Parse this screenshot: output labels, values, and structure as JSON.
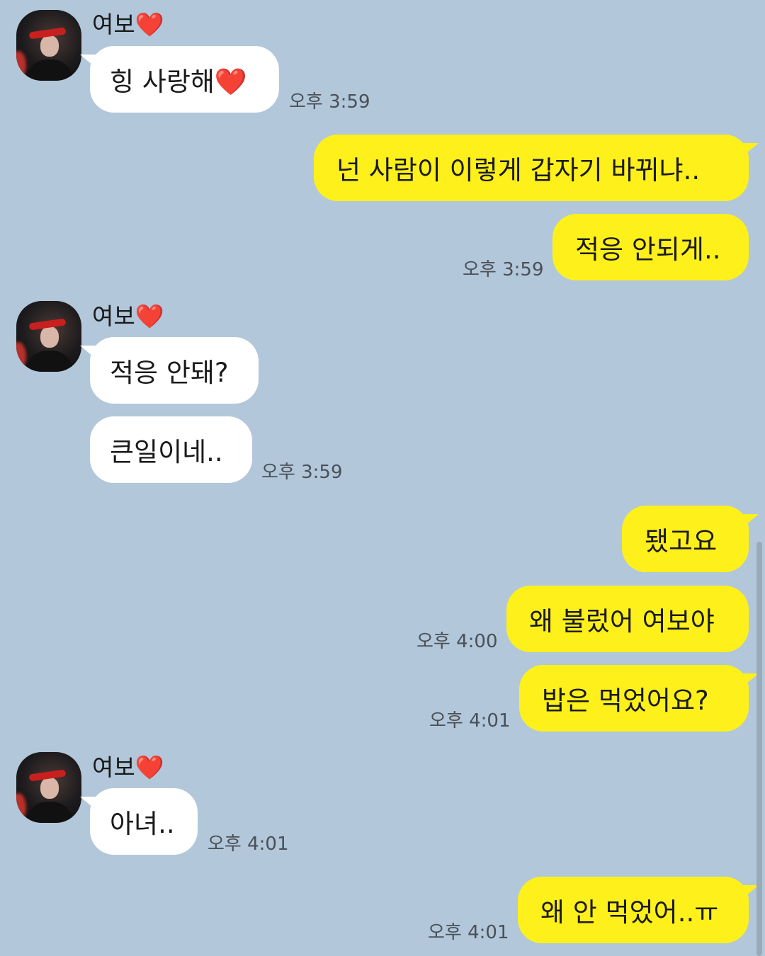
{
  "contact": {
    "name": "여보",
    "heart": "❤️"
  },
  "messages": [
    {
      "id": "m1",
      "side": "in",
      "text": "힝 사랑해❤️",
      "time": "오후 3:59"
    },
    {
      "id": "m2",
      "side": "out",
      "text": "넌 사람이 이렇게 갑자기 바뀌냐..",
      "time": ""
    },
    {
      "id": "m3",
      "side": "out",
      "text": "적응 안되게..",
      "time": "오후 3:59"
    },
    {
      "id": "m4",
      "side": "in",
      "text": "적응 안돼?",
      "time": ""
    },
    {
      "id": "m5",
      "side": "in",
      "text": "큰일이네..",
      "time": "오후 3:59"
    },
    {
      "id": "m6",
      "side": "out",
      "text": "됐고요",
      "time": ""
    },
    {
      "id": "m7",
      "side": "out",
      "text": "왜 불렀어 여보야",
      "time": "오후 4:00"
    },
    {
      "id": "m8",
      "side": "out",
      "text": "밥은 먹었어요?",
      "time": "오후 4:01"
    },
    {
      "id": "m9",
      "side": "in",
      "text": "아녀..",
      "time": "오후 4:01"
    },
    {
      "id": "m10",
      "side": "out",
      "text": "왜 안 먹었어..ㅠ",
      "time": "오후 4:01"
    }
  ],
  "colors": {
    "background": "#b2c7d9",
    "incoming_bubble": "#ffffff",
    "outgoing_bubble": "#fef01b"
  },
  "icons": {
    "avatar": "profile-photo-icon"
  }
}
